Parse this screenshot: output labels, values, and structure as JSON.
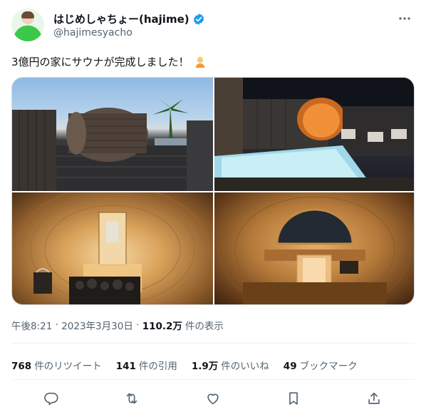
{
  "author": {
    "display_name": "はじめしゃちょー(hajime)",
    "handle": "@hajimesyacho",
    "avatar_icon": "avatar-image",
    "verified_icon": "verified-badge-icon",
    "verified_color": "#1d9bf0"
  },
  "tweet": {
    "text": "3億円の家にサウナが完成しました！",
    "emoji_icon": "person-emoji-icon"
  },
  "media": {
    "photos": [
      {
        "icon": "photo-barrel-sauna-deck"
      },
      {
        "icon": "photo-night-pool-sauna"
      },
      {
        "icon": "photo-sauna-interior-stove"
      },
      {
        "icon": "photo-sauna-interior-window"
      }
    ]
  },
  "meta": {
    "time": "午後8:21",
    "sep1": " · ",
    "date": "2023年3月30日",
    "sep2": " · ",
    "views_count": "110.2万",
    "views_label": "件の表示"
  },
  "stats": {
    "retweets_count": "768",
    "retweets_label": "件のリツイート",
    "quotes_count": "141",
    "quotes_label": "件の引用",
    "likes_count": "1.9万",
    "likes_label": "件のいいね",
    "bookmarks_count": "49",
    "bookmarks_label": "ブックマーク"
  },
  "actions": {
    "reply_icon": "reply-icon",
    "retweet_icon": "retweet-icon",
    "like_icon": "heart-icon",
    "bookmark_icon": "bookmark-icon",
    "share_icon": "share-icon"
  },
  "colors": {
    "text_primary": "#0f1419",
    "text_secondary": "#536471",
    "divider": "#eff3f4"
  }
}
